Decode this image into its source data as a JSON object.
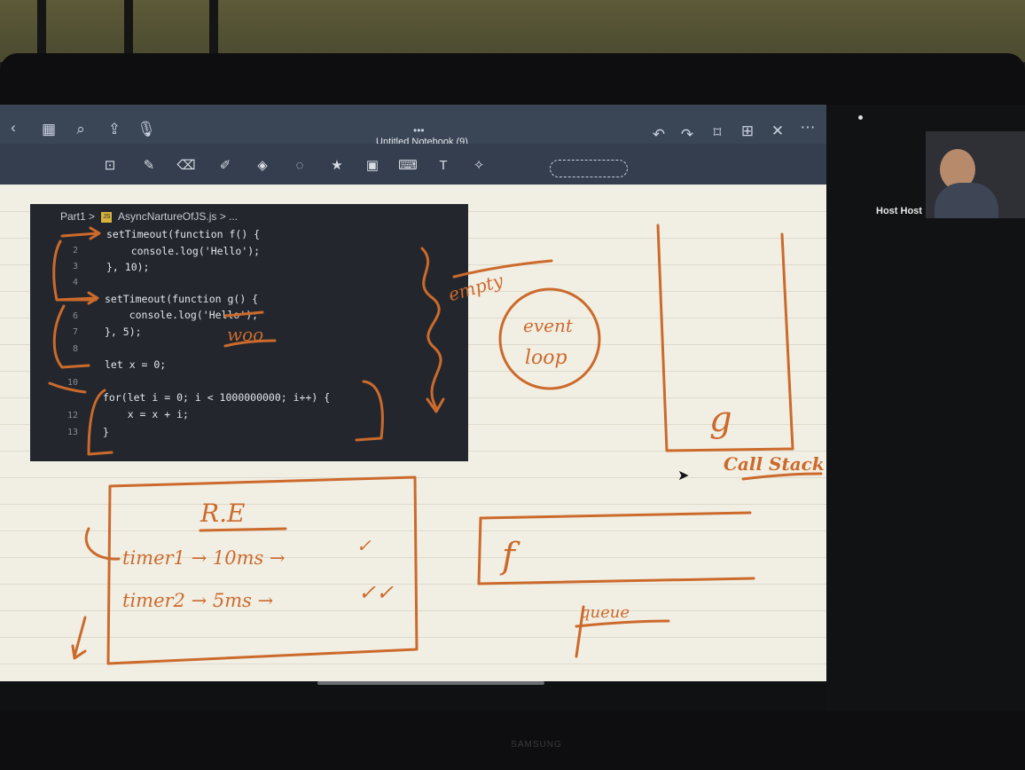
{
  "app": {
    "title": "Untitled Notebook (9)",
    "more_dots": "•••",
    "icons": [
      "chevron-left-icon",
      "grid-icon",
      "search-icon",
      "share-icon",
      "microphone-icon",
      "undo-icon",
      "redo-icon",
      "bookmark-icon",
      "add-page-icon",
      "close-icon",
      "more-icon"
    ],
    "tools": [
      "document-scan-icon",
      "pen-icon",
      "eraser-icon",
      "highlighter-icon",
      "shapes-icon",
      "lasso-icon",
      "sticker-icon",
      "image-icon",
      "keyboard-icon",
      "text-icon",
      "laser-pointer-icon"
    ]
  },
  "code": {
    "breadcrumb_part": "Part1 >",
    "breadcrumb_icon": "JS",
    "breadcrumb_file": "AsyncNartureOfJS.js > ...",
    "line_numbers": [
      "2",
      "3",
      "4",
      "6",
      "7",
      "8",
      "10",
      "12",
      "13"
    ],
    "lines": [
      "setTimeout(function f() {",
      "    console.log('Hello');",
      "}, 10);",
      "setTimeout(function g() {",
      "    console.log('Hello');",
      "}, 5);",
      "let x = 0;",
      "for(let i = 0; i < 1000000000; i++) {",
      "    x = x + i;",
      "}"
    ]
  },
  "handwriting": {
    "woo": "woo",
    "empty": "empty",
    "event_loop_1": "event",
    "event_loop_2": "loop",
    "g": "g",
    "call_stack": "Call Stack",
    "re": "R.E",
    "timer1": "timer1 → 10ms →",
    "timer2": "timer2 → 5ms →",
    "f": "f",
    "queue": "queue"
  },
  "meeting": {
    "participant_name": "Host Host"
  },
  "monitor": {
    "brand": "SAMSUNG"
  },
  "colors": {
    "ink": "#cc6a2c",
    "page": "#f1efe4",
    "code_bg": "#23272d",
    "topbar": "#3a4556"
  }
}
